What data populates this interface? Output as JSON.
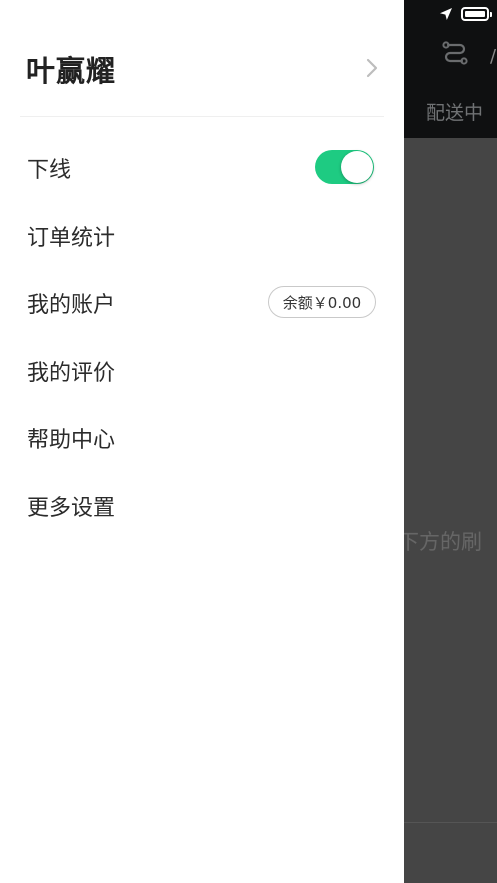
{
  "background_app": {
    "tab_label": "配送中",
    "hint_fragment": "下方的刷"
  },
  "drawer": {
    "user": {
      "name": "叶赢耀"
    },
    "menu": {
      "offline": {
        "label": "下线",
        "toggle_on": true
      },
      "order_stats": {
        "label": "订单统计"
      },
      "my_account": {
        "label": "我的账户",
        "balance": "余额￥0.00"
      },
      "my_reviews": {
        "label": "我的评价"
      },
      "help_center": {
        "label": "帮助中心"
      },
      "more_settings": {
        "label": "更多设置"
      }
    }
  },
  "colors": {
    "toggle_on": "#1ecb82",
    "overlay_dark": "#454545",
    "topbar_dark": "#0f1011"
  },
  "icons": {
    "profile_chevron": "chevron-right-icon",
    "route": "route-icon",
    "location": "location-arrow-icon",
    "battery": "battery-icon"
  }
}
